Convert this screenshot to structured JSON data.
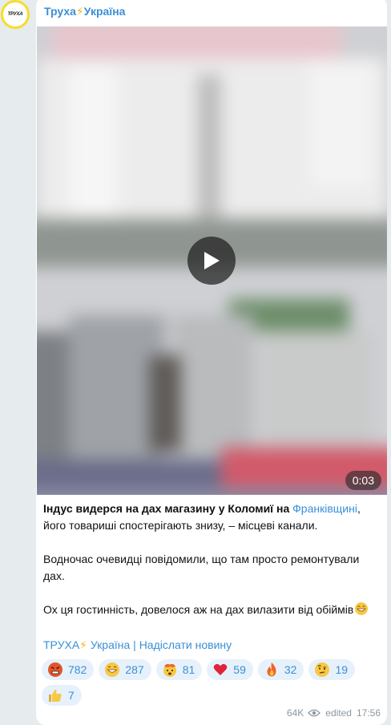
{
  "channel": {
    "avatar_text": "ТРУХА",
    "name": "Труха",
    "name_suffix": "Україна"
  },
  "video": {
    "duration": "0:03"
  },
  "post": {
    "p1_before": "Індус видерся на дах магазину у Коломиї на ",
    "p1_link": "Франківщині",
    "p1_after": ", його товариші спостерігають знизу, – місцеві канали.",
    "p2": "Водночас очевидці повідомили, що там просто ремонтували дах.",
    "p3": "Ох ця гостинність, довелося аж на дах вилазити від обіймів"
  },
  "signature": {
    "channel": "ТРУХА",
    "channel_suffix": " Україна",
    "separator": " | ",
    "cta": "Надіслати новину"
  },
  "reactions": [
    {
      "icon": "angry-face-icon",
      "count": "782"
    },
    {
      "icon": "grinning-face-icon",
      "count": "287"
    },
    {
      "icon": "exploding-head-icon",
      "count": "81"
    },
    {
      "icon": "red-heart-icon",
      "count": "59"
    },
    {
      "icon": "fire-icon",
      "count": "32"
    },
    {
      "icon": "raised-eyebrow-face-icon",
      "count": "19"
    },
    {
      "icon": "thumbs-up-icon",
      "count": "7"
    }
  ],
  "meta": {
    "views": "64K",
    "edited_label": "edited",
    "time": "17:56"
  },
  "colors": {
    "accent": "#3a8fd6",
    "reaction_bg": "#e7f1fb",
    "bolt": "#f2b418",
    "avatar_ring": "#f6dd2a"
  }
}
